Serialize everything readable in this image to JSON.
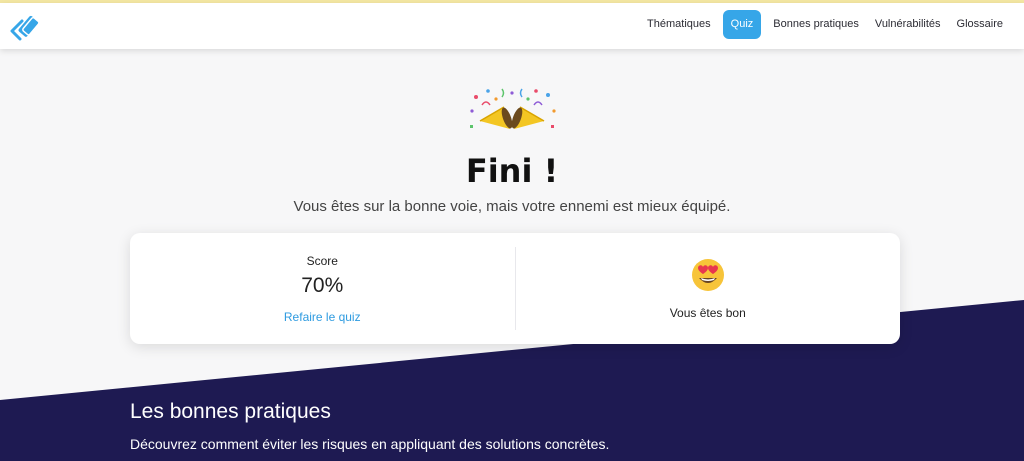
{
  "header": {
    "nav": [
      {
        "label": "Thématiques",
        "active": false
      },
      {
        "label": "Quiz",
        "active": true
      },
      {
        "label": "Bonnes pratiques",
        "active": false
      },
      {
        "label": "Vulnérabilités",
        "active": false
      },
      {
        "label": "Glossaire",
        "active": false
      }
    ],
    "logo_icon": "brand-logo-icon",
    "accent_color": "#36a6e8"
  },
  "hero": {
    "icon": "party-popper-icon",
    "title": "Fini !",
    "subtitle": "Vous êtes sur la bonne voie, mais votre ennemi est mieux équipé."
  },
  "result": {
    "score_label": "Score",
    "score_value": "70%",
    "retry_link": "Refaire le quiz",
    "verdict_icon": "heart-eyes-icon",
    "verdict": "Vous êtes bon"
  },
  "practices": {
    "title": "Les bonnes pratiques",
    "description": "Découvrez comment éviter les risques en appliquant des solutions concrètes.",
    "background_color": "#1e1a52"
  }
}
